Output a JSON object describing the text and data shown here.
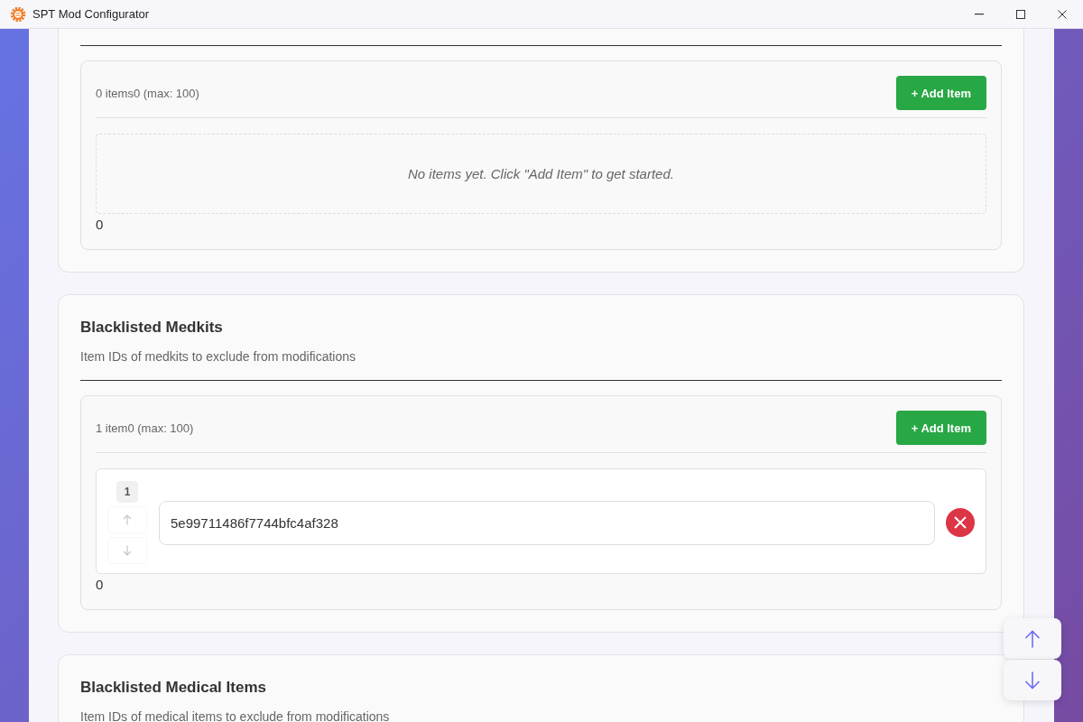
{
  "window": {
    "title": "SPT Mod Configurator"
  },
  "sections": [
    {
      "list": {
        "summary": "0 items0 (max: 100)",
        "add_button": "+ Add Item",
        "empty_message": "No items yet. Click \"Add Item\" to get started.",
        "footer": "0"
      }
    },
    {
      "title": "Blacklisted Medkits",
      "description": "Item IDs of medkits to exclude from modifications",
      "list": {
        "summary": "1 item0 (max: 100)",
        "add_button": "+ Add Item",
        "items": [
          {
            "number": "1",
            "value": "5e99711486f7744bfc4af328",
            "up_disabled": true,
            "down_disabled": true
          }
        ],
        "footer": "0"
      }
    },
    {
      "title": "Blacklisted Medical Items",
      "description": "Item IDs of medical items to exclude from modifications"
    }
  ]
}
